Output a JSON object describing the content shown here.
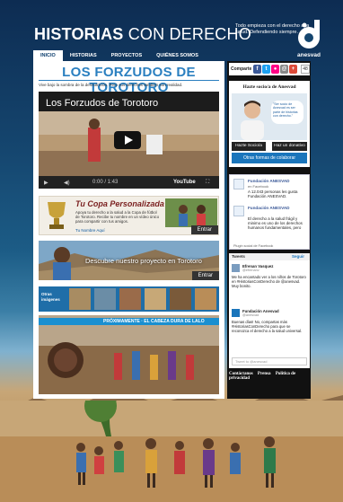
{
  "header": {
    "title_bold": "HISTORIAS",
    "title_light": "CON DERECHO",
    "tagline": "Todo empieza con el derecho a la salud. Defendiendo siempre.",
    "logo_text": "anesvad"
  },
  "nav": {
    "items": [
      "Inicio",
      "Historias",
      "Proyectos",
      "Quiénes somos"
    ],
    "active_index": 0
  },
  "main": {
    "heading": "LOS FORZUDOS DE TOROTORO",
    "intro": "Vive bajo la sombra de la desnutrición. Pero sus derechos también son realidad.",
    "video": {
      "title": "Los Forzudos de Torotoro",
      "time": "0:00 / 1:43",
      "brand": "YouTube"
    },
    "copa_banner": {
      "title": "Tu Copa Personalizada",
      "text": "Apoya tu derecho a la salud a la Copa de fútbol de Torotoro. Recibe tu nombre en un vídeo único para compartir con tus amigos.",
      "cta": "Tu Nombre Aquí",
      "button": "Entrar"
    },
    "descubre_banner": {
      "text": "Descubre nuestro proyecto en Torotoro",
      "button": "Entrar"
    },
    "otras": {
      "label": "Otras imágenes"
    },
    "lalo_banner": {
      "strip": "PRÓXIMAMENTE · EL CABEZA DURA DE LALO"
    }
  },
  "sidebar": {
    "social": {
      "label": "Comparte",
      "icons": [
        {
          "name": "facebook-icon",
          "glyph": "f",
          "color": "#3b5998"
        },
        {
          "name": "twitter-icon",
          "glyph": "t",
          "color": "#1da1f2"
        },
        {
          "name": "flickr-icon",
          "glyph": "●",
          "color": "#ff0084"
        },
        {
          "name": "email-icon",
          "glyph": "@",
          "color": "#888888"
        },
        {
          "name": "plus-icon",
          "glyph": "+",
          "color": "#dd4b39"
        }
      ],
      "count": "48"
    },
    "hazte": {
      "title": "Hazte socio/a de Anesvad",
      "quote": "\"Ser socio de Anesvad es ser parte de historias con derecho.\"",
      "btn_socio": "Hazte Socio/a",
      "btn_donativo": "Haz un donativo",
      "btn_solidario": "Otras formas de colaborar"
    },
    "facebook": {
      "items": [
        {
          "name": "Fundación ANESVAD",
          "sub": "en Facebook",
          "text": "A 12.043 personas les gusta Fundación ANESVAD."
        },
        {
          "name": "Fundación ANESVAD",
          "sub": "",
          "text": "El derecho a la salud frágil y minimo es uno de los derechos humanos fundamentales, pero"
        }
      ],
      "plugin": "Plugin social de Facebook"
    },
    "twitter": {
      "header_left": "Tweets",
      "header_right": "Seguir",
      "items": [
        {
          "name": "Efrenan Vasquez",
          "handle": "@efrenanv",
          "text": "Me ha encantado ver a los niños de Torotoro en #HistoriasConDerecho de @anesvad. Muy bonito."
        },
        {
          "name": "Fundación Anesvad",
          "handle": "@anesvad",
          "text": "Buenas días! No, compartas más #HistoriasConDerecho para que se reconozca el derecho a la salud universal."
        }
      ],
      "reply_placeholder": "Tweet to @anesvad"
    },
    "footer_links": [
      "Contáctanos",
      "Prensa",
      "Política de privacidad"
    ]
  }
}
